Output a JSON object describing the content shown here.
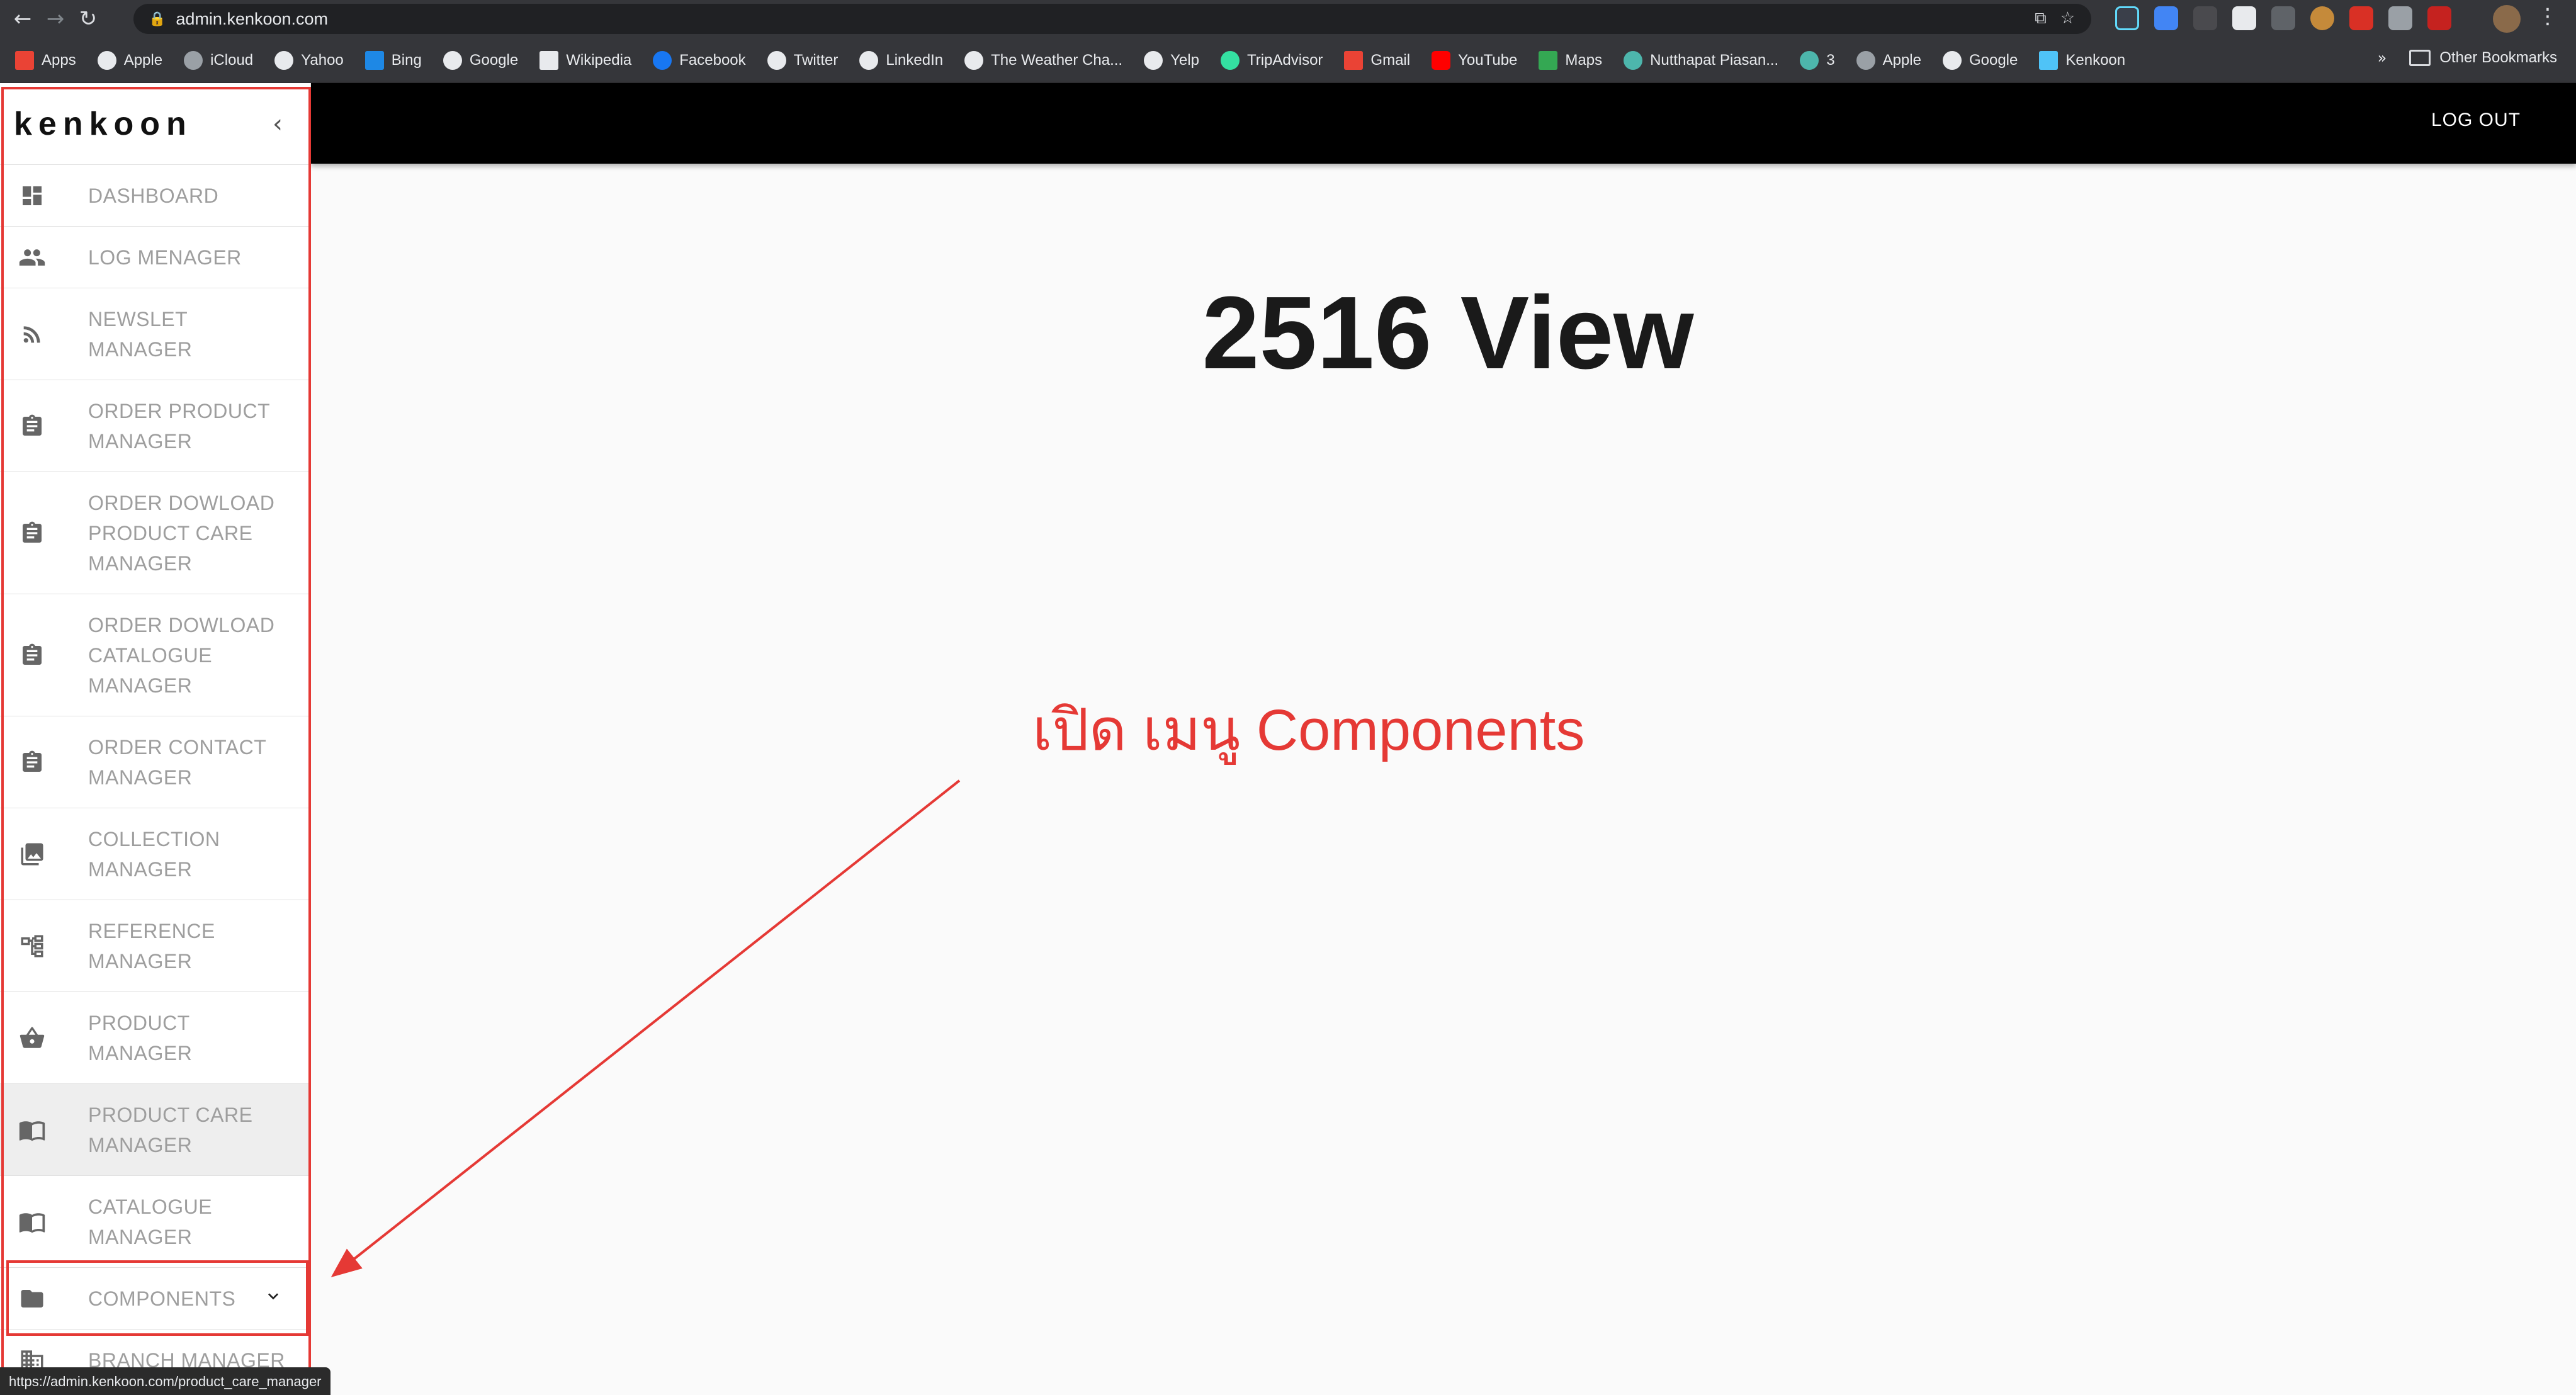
{
  "browser": {
    "url": "admin.kenkoon.com",
    "bookmarks": [
      {
        "label": "Apps",
        "color": "#ea4335"
      },
      {
        "label": "Apple",
        "color": "#e8eaed"
      },
      {
        "label": "iCloud",
        "color": "#9aa0a6"
      },
      {
        "label": "Yahoo",
        "color": "#e8eaed"
      },
      {
        "label": "Bing",
        "color": "#1e88e5"
      },
      {
        "label": "Google",
        "color": "#e8eaed"
      },
      {
        "label": "Wikipedia",
        "color": "#e8eaed"
      },
      {
        "label": "Facebook",
        "color": "#1877f2"
      },
      {
        "label": "Twitter",
        "color": "#e8eaed"
      },
      {
        "label": "LinkedIn",
        "color": "#e8eaed"
      },
      {
        "label": "The Weather Cha...",
        "color": "#e8eaed"
      },
      {
        "label": "Yelp",
        "color": "#e8eaed"
      },
      {
        "label": "TripAdvisor",
        "color": "#34e0a1"
      },
      {
        "label": "Gmail",
        "color": "#ea4335"
      },
      {
        "label": "YouTube",
        "color": "#ff0000"
      },
      {
        "label": "Maps",
        "color": "#34a853"
      },
      {
        "label": "Nutthapat Piasan...",
        "color": "#4db6ac"
      },
      {
        "label": "3",
        "color": "#4db6ac"
      },
      {
        "label": "Apple",
        "color": "#9aa0a6"
      },
      {
        "label": "Google",
        "color": "#e8eaed"
      },
      {
        "label": "Kenkoon",
        "color": "#4fc3f7"
      }
    ],
    "overflow_chevron": "»",
    "other_bookmarks": "Other Bookmarks",
    "status_url": "https://admin.kenkoon.com/product_care_manager"
  },
  "header": {
    "logout": "LOG OUT"
  },
  "sidebar": {
    "brand": "kenkoon",
    "collapse_icon": "‹",
    "items": [
      {
        "label": "DASHBOARD",
        "icon": "dashboard-icon"
      },
      {
        "label": "LOG MENAGER",
        "icon": "people-icon"
      },
      {
        "label": "NEWSLET MANAGER",
        "icon": "rss-icon"
      },
      {
        "label": "ORDER PRODUCT MANAGER",
        "icon": "clipboard-icon"
      },
      {
        "label": "ORDER DOWLOAD PRODUCT CARE MANAGER",
        "icon": "clipboard-icon"
      },
      {
        "label": "ORDER DOWLOAD CATALOGUE MANAGER",
        "icon": "clipboard-icon"
      },
      {
        "label": "ORDER CONTACT MANAGER",
        "icon": "clipboard-icon"
      },
      {
        "label": "COLLECTION MANAGER",
        "icon": "photo-library-icon"
      },
      {
        "label": "REFERENCE MANAGER",
        "icon": "tree-icon"
      },
      {
        "label": "PRODUCT MANAGER",
        "icon": "basket-icon"
      },
      {
        "label": "PRODUCT CARE MANAGER",
        "icon": "book-icon",
        "active": true
      },
      {
        "label": "CATALOGUE MANAGER",
        "icon": "book-icon"
      },
      {
        "label": "COMPONENTS",
        "icon": "folder-icon",
        "expandable": true
      },
      {
        "label": "BRANCH MANAGER",
        "icon": "building-icon"
      }
    ]
  },
  "main": {
    "view_count": "2516 View",
    "annotation": "เปิด เมนู Components"
  },
  "colors": {
    "annotation": "#e53935",
    "header_bg": "#000000",
    "menu_text": "#9e9e9e"
  }
}
